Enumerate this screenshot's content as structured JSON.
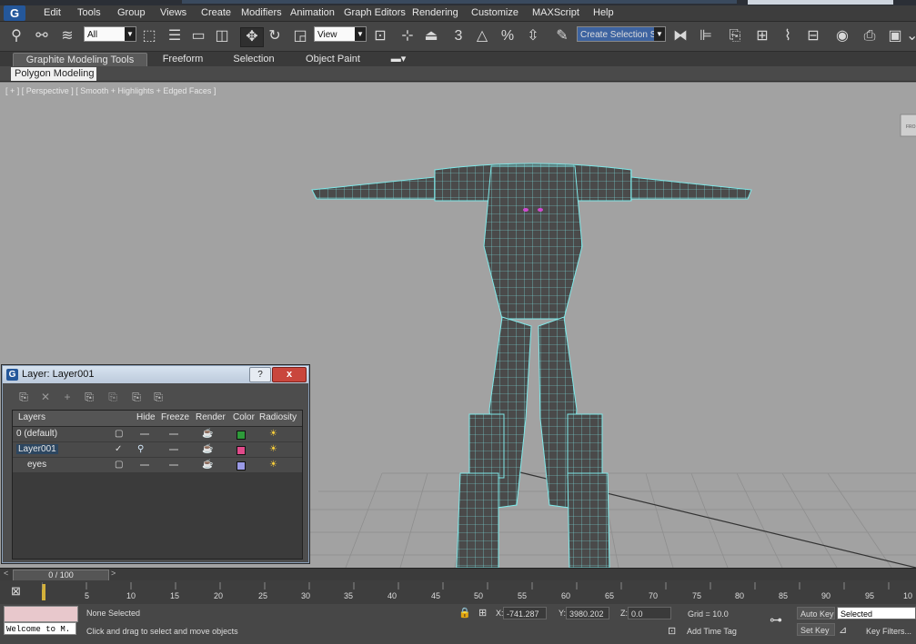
{
  "menubar": {
    "logo": "G",
    "items": [
      "Edit",
      "Tools",
      "Group",
      "Views",
      "Create",
      "Modifiers",
      "Animation",
      "Graph Editors",
      "Rendering",
      "Customize",
      "MAXScript",
      "Help"
    ]
  },
  "toolbar": {
    "selection_filter": "All",
    "ref_coord": "View",
    "snap_label": "3",
    "named_selection": "Create Selection Se"
  },
  "ribbon": {
    "tabs": [
      "Graphite Modeling Tools",
      "Freeform",
      "Selection",
      "Object Paint"
    ],
    "active_tab": "Graphite Modeling Tools",
    "panel": "Polygon Modeling"
  },
  "viewport": {
    "label": "[ + ] [ Perspective ] [ Smooth + Highlights + Edged Faces ]",
    "viewcube_label": "FRO",
    "wire_color": "#7fe8e8",
    "shade_color": "#4a4a4a"
  },
  "layer_dialog": {
    "title": "Layer: Layer001",
    "help": "?",
    "close": "x",
    "columns": [
      "Layers",
      "Hide",
      "Freeze",
      "Render",
      "Color",
      "Radiosity"
    ],
    "rows": [
      {
        "name": "0 (default)",
        "active": false,
        "color": "#2e9a3a"
      },
      {
        "name": "Layer001",
        "active": true,
        "color": "#e04a8a"
      },
      {
        "name": "eyes",
        "active": false,
        "color": "#9a9ae6"
      }
    ]
  },
  "timeline": {
    "frame": "0 / 100",
    "ticks": [
      "5",
      "10",
      "15",
      "20",
      "25",
      "30",
      "35",
      "40",
      "45",
      "50",
      "55",
      "60",
      "65",
      "70",
      "75",
      "80",
      "85",
      "90",
      "95",
      "10"
    ]
  },
  "status": {
    "selection": "None Selected",
    "prompt": "Click and drag to select and move objects",
    "listener": "Welcome to M.",
    "x_label": "X:",
    "x_value": "-741.287",
    "y_label": "Y:",
    "y_value": "3980.202",
    "z_label": "Z:",
    "z_value": "0.0",
    "grid": "Grid = 10.0",
    "add_time_tag": "Add Time Tag",
    "auto_key": "Auto Key",
    "set_key": "Set Key",
    "key_mode": "Selected",
    "key_filters": "Key Filters..."
  }
}
